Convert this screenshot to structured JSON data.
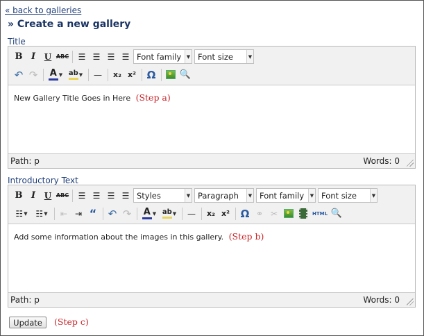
{
  "nav": {
    "back_link": "« back to galleries"
  },
  "page": {
    "title": "» Create a new gallery"
  },
  "title_field": {
    "label": "Title",
    "toolbar": {
      "font_family": "Font family",
      "font_size": "Font size"
    },
    "content": "New Gallery Title Goes in Here",
    "step_note": "(Step a)",
    "path": "Path: p",
    "words": "Words: 0"
  },
  "intro_field": {
    "label": "Introductory Text",
    "toolbar": {
      "styles": "Styles",
      "format": "Paragraph",
      "font_family": "Font family",
      "font_size": "Font size",
      "html_label": "HTML"
    },
    "content": "Add some information about the images in this gallery.",
    "step_note": "(Step b)",
    "path": "Path: p",
    "words": "Words: 0"
  },
  "form": {
    "update_label": "Update",
    "step_note": "(Step c)"
  },
  "icons": {
    "bold": "B",
    "italic": "I",
    "underline": "U",
    "strike": "ABC",
    "undo": "↶",
    "redo": "↷",
    "hr": "—",
    "subscript": "x₂",
    "superscript": "x²",
    "omega": "Ω",
    "quote": "“",
    "font_color": "A",
    "highlight": "ab"
  },
  "colors": {
    "link": "#1f3f7a",
    "step_note": "#c8262b",
    "font_color_bar": "#2a3aa0",
    "highlight_bar": "#e9d55a"
  }
}
